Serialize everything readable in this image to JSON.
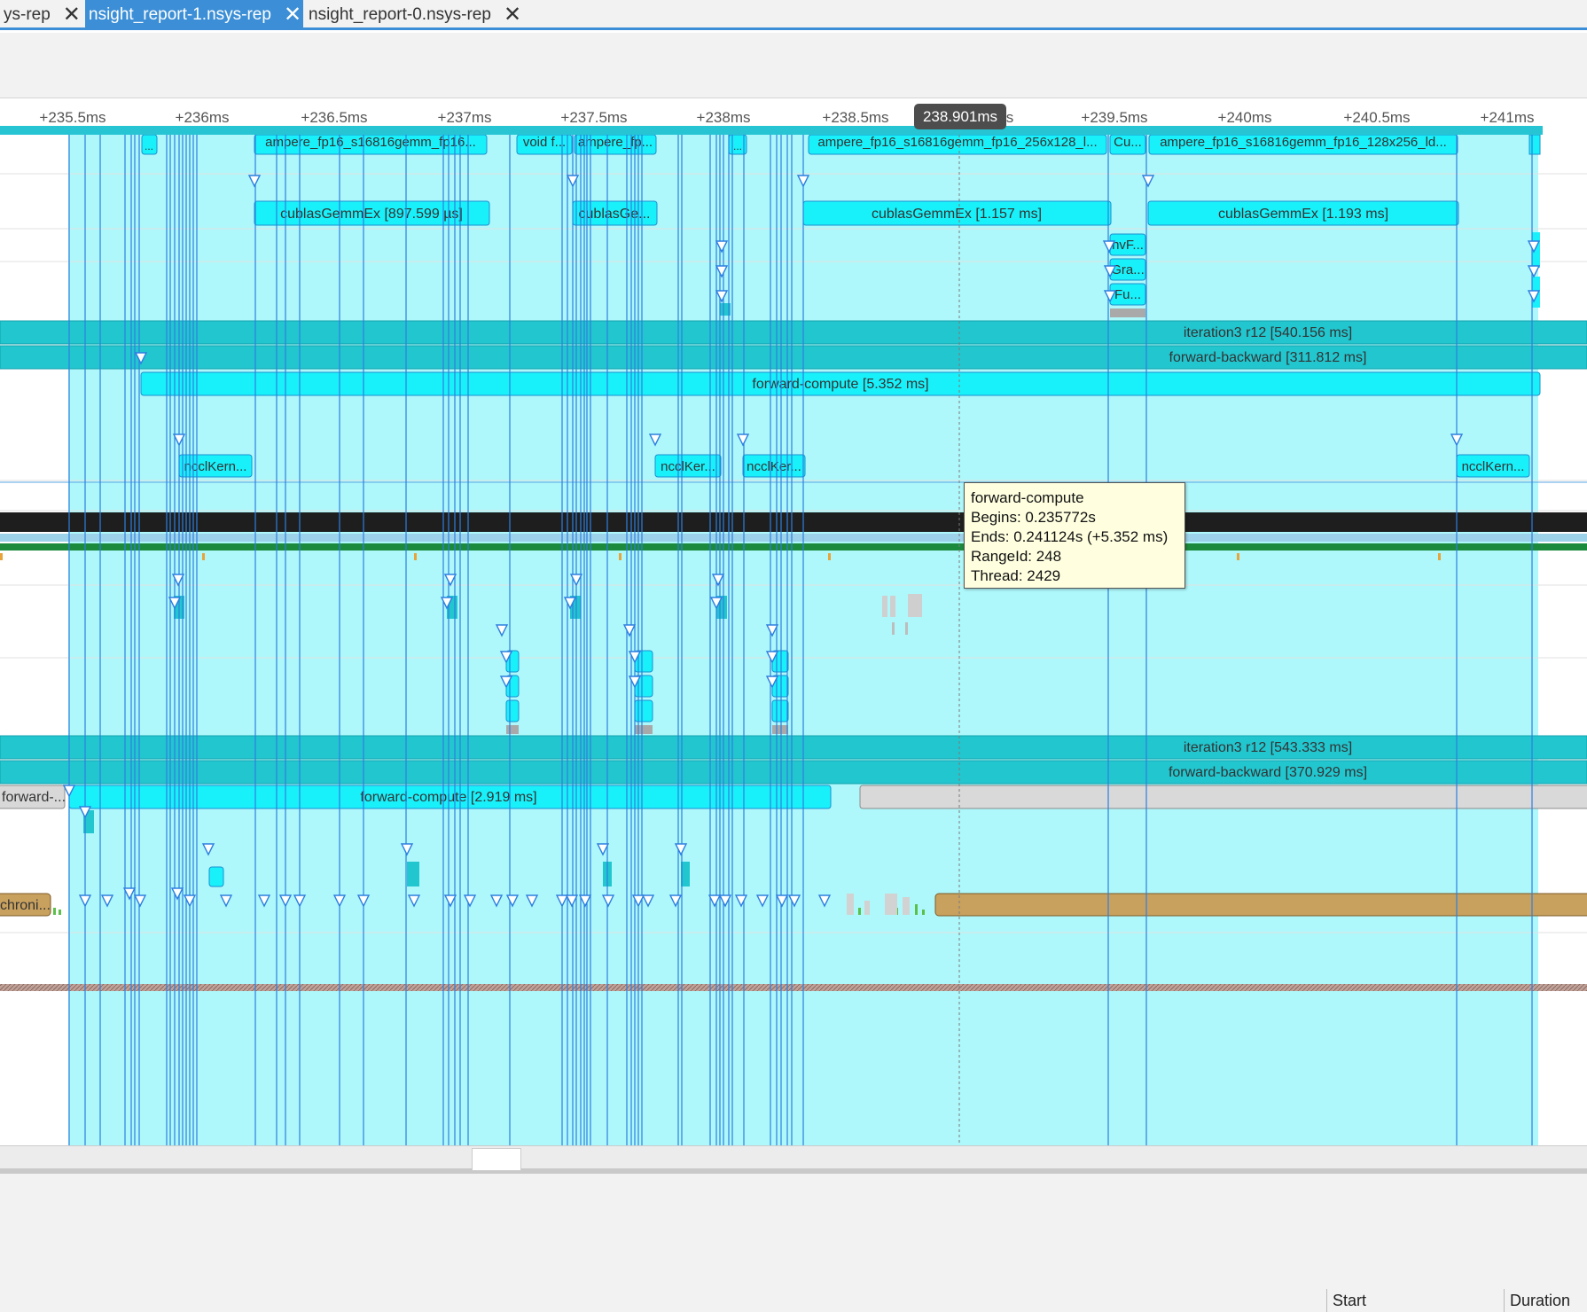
{
  "tabs": [
    {
      "label": "ys-rep",
      "active": false
    },
    {
      "label": "nsight_report-1.nsys-rep",
      "active": true
    },
    {
      "label": "nsight_report-0.nsys-rep",
      "active": false
    }
  ],
  "close_glyph": "✕",
  "ruler": {
    "ticks": [
      "+235.5ms",
      "+236ms",
      "+236.5ms",
      "+237ms",
      "+237.5ms",
      "+238ms",
      "+238.5ms",
      "s",
      "+239.5ms",
      "+240ms",
      "+240.5ms",
      "+241ms"
    ],
    "cursor_time": "238.901ms"
  },
  "bars": {
    "k1": "ampere_fp16_s16816gemm_fp16...",
    "k2": "void f...",
    "k3": "ampere_fp...",
    "k4": "ampere_fp16_s16816gemm_fp16_256x128_l...",
    "k5": "Cu...",
    "k6": "ampere_fp16_s16816gemm_fp16_128x256_ld...",
    "ellipsis": "...",
    "c1": "cublasGemmEx [897.599 µs]",
    "c2": "cublasGe...",
    "c3": "cublasGemmEx [1.157 ms]",
    "c4": "cublasGemmEx [1.193 ms]",
    "nv1": "nvF...",
    "nv2": "Gra...",
    "nv3": "Fu...",
    "it1": "iteration3 r12 [540.156 ms]",
    "fb1": "forward-backward [311.812 ms]",
    "fc1": "forward-compute [5.352 ms]",
    "n1": "ncclKern...",
    "n2": "ncclKer...",
    "n3": "ncclKer...",
    "n4": "ncclKern...",
    "it2": "iteration3 r12 [543.333 ms]",
    "fb2": "forward-backward [370.929 ms]",
    "fc2l": "forward-...",
    "fc2": "forward-compute [2.919 ms]",
    "sync": "chroni..."
  },
  "tooltip": {
    "title": "forward-compute",
    "begins": "Begins: 0.235772s",
    "ends": "Ends: 0.241124s (+5.352 ms)",
    "range_id": "RangeId: 248",
    "thread": "Thread: 2429"
  },
  "events_table": {
    "columns": [
      "Start",
      "Duration"
    ]
  },
  "colors": {
    "selection": "#aef8fb",
    "nvtx_range": "#22c6cf",
    "range_bar": "#19f1fa",
    "marker_line": "#2d7fe0",
    "tab_active": "#3c8fd6",
    "sync_bar": "#c9a15f"
  }
}
